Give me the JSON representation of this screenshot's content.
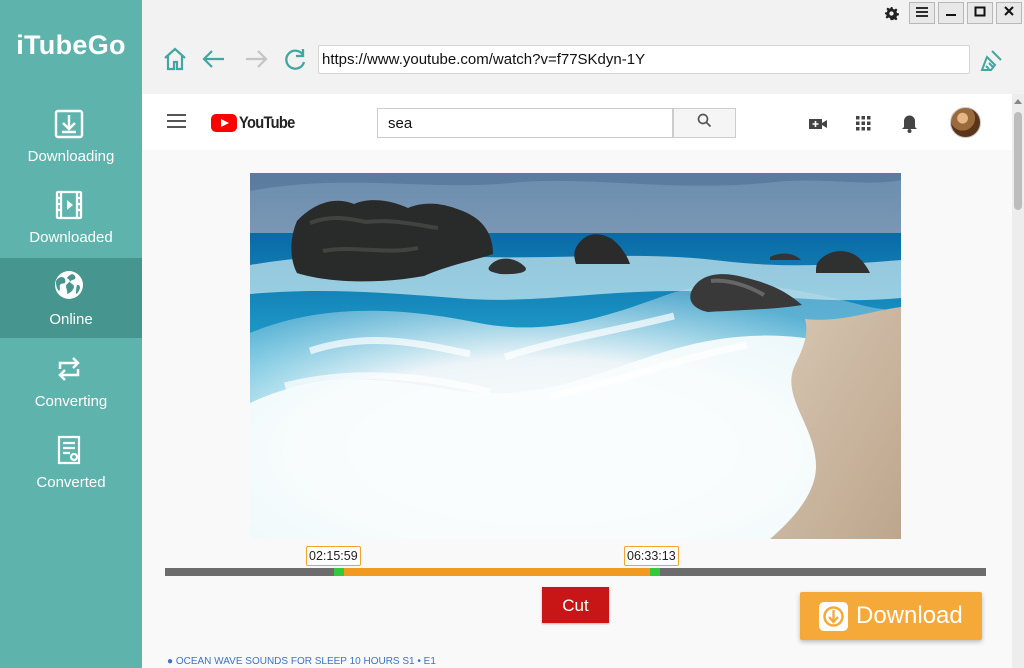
{
  "app": {
    "title": "iTubeGo"
  },
  "sidebar": {
    "items": [
      {
        "label": "Downloading",
        "icon": "download-box-icon",
        "active": false
      },
      {
        "label": "Downloaded",
        "icon": "film-icon",
        "active": false
      },
      {
        "label": "Online",
        "icon": "globe-icon",
        "active": true
      },
      {
        "label": "Converting",
        "icon": "convert-arrows-icon",
        "active": false
      },
      {
        "label": "Converted",
        "icon": "document-icon",
        "active": false
      }
    ]
  },
  "toolbar": {
    "url": "https://www.youtube.com/watch?v=f77SKdyn-1Y"
  },
  "youtube": {
    "logo_text": "YouTube",
    "search_value": "sea"
  },
  "editor": {
    "start_time": "02:15:59",
    "end_time": "06:33:13",
    "range_start_fraction": 0.211,
    "range_end_fraction": 0.596,
    "cut_label": "Cut"
  },
  "download": {
    "label": "Download"
  },
  "video_info": {
    "title": "OCEAN WAVE SOUNDS FOR SLEEP 10 HOURS",
    "episode": "S1 • E1"
  },
  "colors": {
    "sidebar": "#5fb3ad",
    "sidebar_active": "#46968f",
    "range": "#f09a21",
    "handle": "#34c83b",
    "cut_button": "#c81616",
    "download_button": "#f5a938"
  }
}
